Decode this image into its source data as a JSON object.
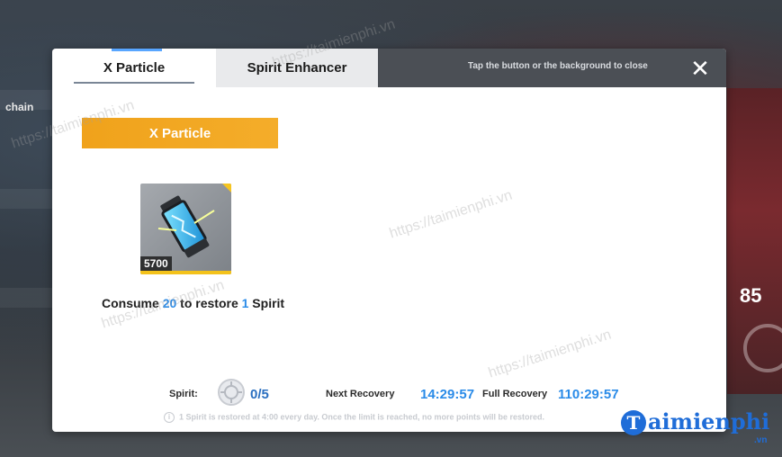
{
  "tabs": [
    {
      "label": "X Particle",
      "active": true
    },
    {
      "label": "Spirit Enhancer",
      "active": false
    }
  ],
  "header": {
    "hint": "Tap the button or the background to close",
    "close_icon": "close-icon"
  },
  "section": {
    "title": "X Particle"
  },
  "item": {
    "name": "X Particle",
    "quantity": "5700",
    "icon": "particle-canister-icon"
  },
  "consume": {
    "prefix": "Consume ",
    "amount": "20",
    "middle": " to restore ",
    "restore": "1",
    "suffix": " Spirit"
  },
  "status": {
    "spirit_label": "Spirit:",
    "spirit_value": "0/5",
    "next_recovery_label": "Next Recovery",
    "next_recovery_value": "14:29:57",
    "full_recovery_label": "Full Recovery",
    "full_recovery_value": "110:29:57"
  },
  "note": "1 Spirit is restored at 4:00 every day. Once the limit is reached, no more points will be restored.",
  "watermark": {
    "text": "https://taimienphi.vn",
    "brand": "aimienphi",
    "brand_initial": "T",
    "brand_suffix": ".vn"
  },
  "background": {
    "left_text": "chain",
    "right_number": "85"
  },
  "colors": {
    "accent_orange": "#f0a21b",
    "accent_blue": "#2a8be8",
    "tab_bar": "#4b4f55"
  }
}
